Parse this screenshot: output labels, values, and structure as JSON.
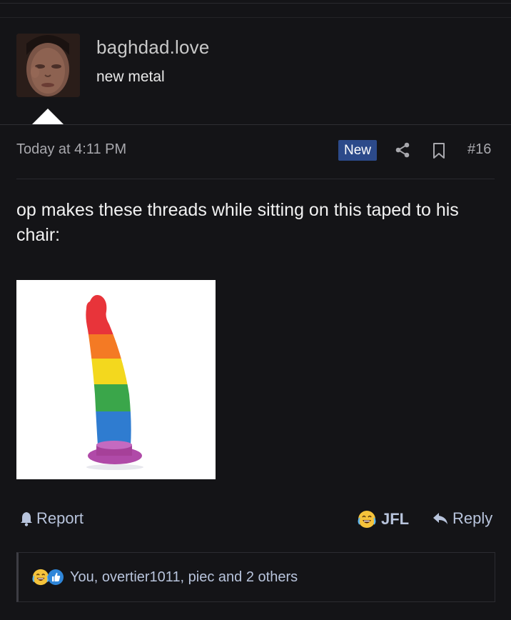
{
  "user": {
    "username": "baghdad.love",
    "title": "new metal"
  },
  "post": {
    "date": "Today at 4:11 PM",
    "new_badge": "New",
    "number": "#16",
    "body": "op makes these threads while sitting on this taped to his chair:"
  },
  "actions": {
    "report": "Report",
    "reaction": "JFL",
    "reply": "Reply"
  },
  "reactions": {
    "summary": "You, overtier1011, piec and 2 others"
  },
  "icons": {
    "share": "share-icon",
    "bookmark": "bookmark-icon",
    "report": "bell-icon",
    "reply": "reply-arrow-icon",
    "jfl": "crying-laughing-emoji-icon",
    "like": "thumbs-up-icon"
  },
  "colors": {
    "background": "#141417",
    "badge": "#2c4a8a",
    "link": "#b8c4dc"
  }
}
